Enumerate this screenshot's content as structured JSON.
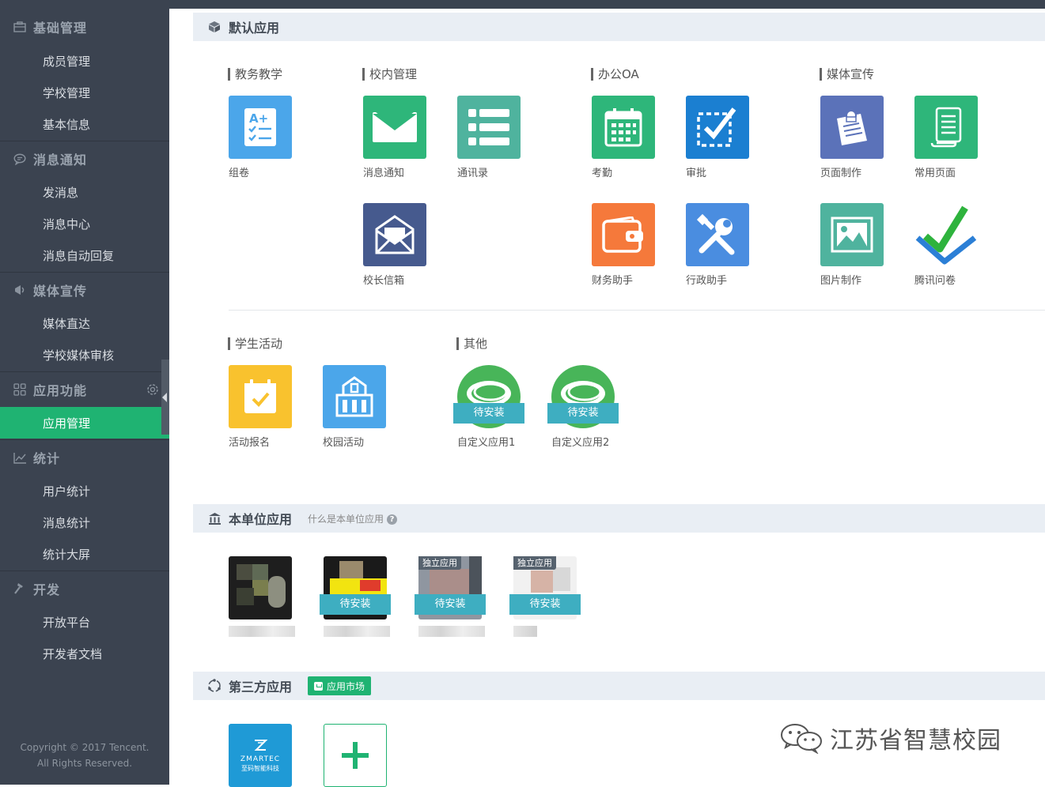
{
  "colors": {
    "sidebar_bg": "#3b4350",
    "accent": "#1fb372",
    "section_header_bg": "#e9eef4",
    "install_band": "#3eaec1"
  },
  "sidebar": {
    "groups": [
      {
        "label": "基础管理",
        "icon": "briefcase-icon",
        "items": [
          "成员管理",
          "学校管理",
          "基本信息"
        ]
      },
      {
        "label": "消息通知",
        "icon": "chat-bubble-icon",
        "items": [
          "发消息",
          "消息中心",
          "消息自动回复"
        ]
      },
      {
        "label": "媒体宣传",
        "icon": "megaphone-icon",
        "items": [
          "媒体直达",
          "学校媒体审核"
        ]
      },
      {
        "label": "应用功能",
        "icon": "grid-icon",
        "items": [
          "应用管理"
        ]
      },
      {
        "label": "统计",
        "icon": "line-chart-icon",
        "items": [
          "用户统计",
          "消息统计",
          "统计大屏"
        ]
      },
      {
        "label": "开发",
        "icon": "hammer-icon",
        "items": [
          "开放平台",
          "开发者文档"
        ]
      }
    ],
    "active_item": "应用管理",
    "copyright_line1": "Copyright © 2017 Tencent.",
    "copyright_line2": "All Rights Reserved."
  },
  "default_apps": {
    "title": "默认应用",
    "icon": "cube-icon",
    "categories": {
      "teaching": "教务教学",
      "campus": "校内管理",
      "office": "办公OA",
      "media": "媒体宣传",
      "student": "学生活动",
      "other": "其他"
    },
    "apps": {
      "zujuan": {
        "label": "组卷",
        "icon": "exam-sheet-icon",
        "color": "#4ba6ea"
      },
      "xiaoxi": {
        "label": "消息通知",
        "icon": "envelope-icon",
        "color": "#2eb67a"
      },
      "tongxun": {
        "label": "通讯录",
        "icon": "list-icon",
        "color": "#4fb39e"
      },
      "xinxiang": {
        "label": "校长信箱",
        "icon": "mailbox-icon",
        "color": "#465a8e"
      },
      "kaoqin": {
        "label": "考勤",
        "icon": "calendar-icon",
        "color": "#2eb67a"
      },
      "shenpi": {
        "label": "审批",
        "icon": "check-box-icon",
        "color": "#1b7fd1"
      },
      "caiwu": {
        "label": "财务助手",
        "icon": "wallet-icon",
        "color": "#f5793b"
      },
      "xingzheng": {
        "label": "行政助手",
        "icon": "tools-icon",
        "color": "#4a8de0"
      },
      "yemian": {
        "label": "页面制作",
        "icon": "notepad-icon",
        "color": "#5b72b9"
      },
      "changyong": {
        "label": "常用页面",
        "icon": "scroll-icon",
        "color": "#2eb67a"
      },
      "tupian": {
        "label": "图片制作",
        "icon": "image-icon",
        "color": "#4fb39e"
      },
      "wenjuan": {
        "label": "腾讯问卷",
        "icon": "checkmark-logo-icon",
        "color": "#ffffff"
      },
      "baoming": {
        "label": "活动报名",
        "icon": "calendar-check-icon",
        "color": "#f9c22e"
      },
      "xiaoyuan": {
        "label": "校园活动",
        "icon": "building-icon",
        "color": "#4ba6ea"
      },
      "custom1": {
        "label": "自定义应用1",
        "icon": "chat-bubbles-icon",
        "color": "#48b559",
        "status": "待安装"
      },
      "custom2": {
        "label": "自定义应用2",
        "icon": "chat-bubbles-icon",
        "color": "#48b559",
        "status": "待安装"
      }
    }
  },
  "unit_apps": {
    "title": "本单位应用",
    "icon": "bank-icon",
    "help_text": "什么是本单位应用",
    "help_icon": "question-icon",
    "items": [
      {
        "tag": "",
        "status": ""
      },
      {
        "tag": "",
        "status": "待安装"
      },
      {
        "tag": "独立应用",
        "status": "待安装"
      },
      {
        "tag": "独立应用",
        "status": "待安装"
      }
    ]
  },
  "third_party": {
    "title": "第三方应用",
    "icon": "refresh-circle-icon",
    "market_label": "应用市场",
    "zmartec_brand": "ZMARTEC",
    "zmartec_sub": "至码智能科技",
    "add_icon": "plus-icon"
  },
  "watermark": {
    "text": "江苏省智慧校园",
    "icon": "wechat-icon"
  }
}
